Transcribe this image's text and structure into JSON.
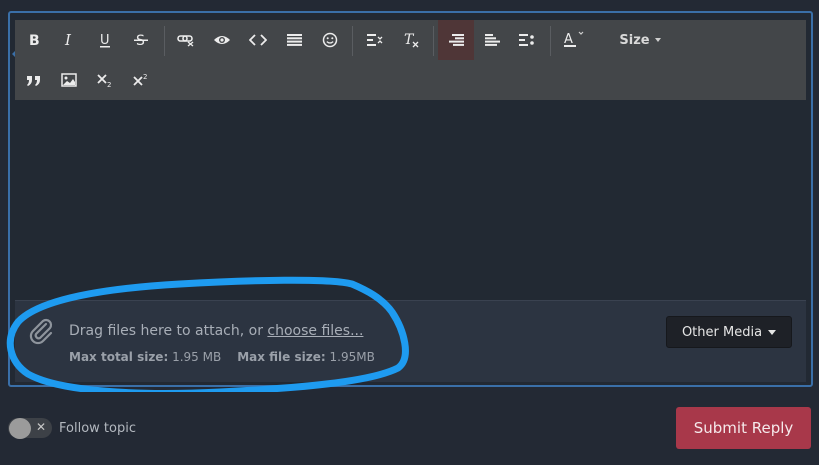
{
  "toolbar": {
    "size_label": "Size",
    "buttons": [
      "bold",
      "italic",
      "underline",
      "strikethrough",
      "remove-link",
      "preview",
      "code",
      "align-justify",
      "emoji",
      "list-dropdown",
      "clear-format",
      "align-right",
      "align-left",
      "more-align",
      "font-color",
      "quote",
      "image",
      "subscript",
      "superscript"
    ]
  },
  "attachments": {
    "drag_text": "Drag files here to attach, or ",
    "choose_link": "choose files...",
    "max_total_label": "Max total size:",
    "max_total_value": "1.95 MB",
    "max_file_label": "Max file size:",
    "max_file_value": "1.95MB",
    "other_media_label": "Other Media"
  },
  "footer": {
    "follow_label": "Follow topic",
    "submit_label": "Submit Reply"
  },
  "colors": {
    "frame_border": "#3a6fa8",
    "highlight_ring": "#1e9bf0",
    "submit_bg": "#a8384a",
    "toolbar_bg": "#434649"
  }
}
